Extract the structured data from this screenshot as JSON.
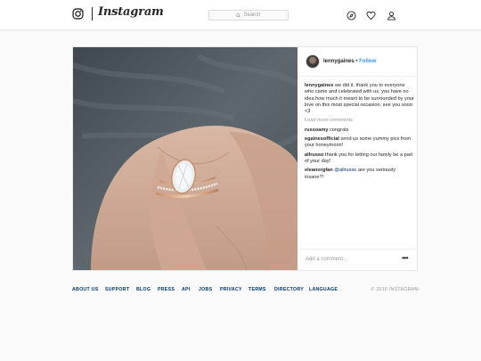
{
  "header": {
    "wordmark": "Instagram",
    "search_placeholder": "Search",
    "icons": [
      "instagram-camera-icon",
      "compass-icon",
      "heart-icon",
      "profile-icon"
    ]
  },
  "post": {
    "username": "lennygaines",
    "separator": "•",
    "follow_label": "Follow",
    "caption": {
      "user": "lennygaines",
      "text": "we did it. thank you to everyone who came and celebrated with us. you have no idea how much it meant to be surrounded by your love on this most special occasion. see you soon <3"
    },
    "load_more": "Load more comments",
    "comments": [
      {
        "user": "russoamy",
        "text": "congrats"
      },
      {
        "user": "egainesofficial",
        "text": "send us some yummy pics from your honeymoon!"
      },
      {
        "user": "allrusso",
        "text": "thank you for letting our family be a part of your day!"
      },
      {
        "user": "eleanorgfan",
        "mention": "@allrusso",
        "text": "are you seriously insane?!"
      }
    ],
    "add_comment_placeholder": "Add a comment...",
    "more_label": "•••"
  },
  "footer": {
    "links": [
      "ABOUT US",
      "SUPPORT",
      "BLOG",
      "PRESS",
      "API",
      "JOBS",
      "PRIVACY",
      "TERMS",
      "DIRECTORY",
      "LANGUAGE"
    ],
    "copyright": "© 2018 INSTAGRAM"
  }
}
